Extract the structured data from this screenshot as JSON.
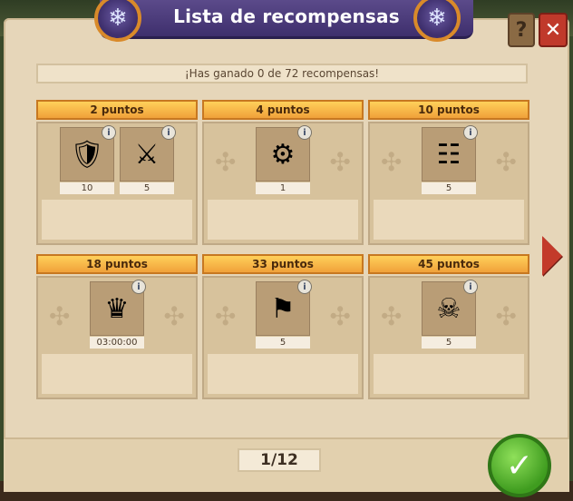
{
  "window": {
    "title": "Lista de recompensas",
    "help_label": "?",
    "close_label": "✕"
  },
  "summary": "¡Has ganado 0 de 72 recompensas!",
  "rewards": [
    {
      "points": "2 puntos",
      "items": [
        {
          "icon": "knight-unit-icon",
          "glyph": "🛡",
          "count": "10"
        },
        {
          "icon": "swordsman-unit-icon",
          "glyph": "⚔",
          "count": "5"
        }
      ]
    },
    {
      "points": "4 puntos",
      "items": [
        {
          "icon": "siege-cannon-icon",
          "glyph": "⚙",
          "count": "1"
        }
      ]
    },
    {
      "points": "10 puntos",
      "items": [
        {
          "icon": "ladder-icon",
          "glyph": "☷",
          "count": "5"
        }
      ]
    },
    {
      "points": "18 puntos",
      "items": [
        {
          "icon": "royal-cushion-boost-icon",
          "glyph": "♛",
          "count": "03:00:00"
        }
      ]
    },
    {
      "points": "33 puntos",
      "items": [
        {
          "icon": "banner-flag-icon",
          "glyph": "⚑",
          "count": "5"
        }
      ]
    },
    {
      "points": "45 puntos",
      "items": [
        {
          "icon": "skull-battering-ram-icon",
          "glyph": "☠",
          "count": "5"
        }
      ]
    }
  ],
  "pagination": {
    "label": "1/12"
  },
  "colors": {
    "header_gold": "#f0a13a",
    "banner_purple": "#3e2f6d",
    "confirm_green": "#3f9c1f",
    "close_red": "#c0392b"
  }
}
